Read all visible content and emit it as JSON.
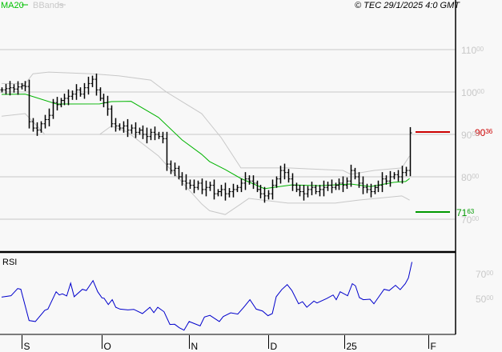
{
  "header": {
    "legend": [
      {
        "label": "MA20",
        "color": "#00c000"
      },
      {
        "label": "BBands",
        "color": "#c8c8c8"
      }
    ],
    "copyright": "© TEC 29/1/2025 4:0 GMT"
  },
  "colors": {
    "price": "#000000",
    "ma": "#00b400",
    "bands": "#c8c8c8",
    "rsi": "#0000cc",
    "resistance": "#cc0000",
    "support": "#009900",
    "grid": "#c8c8c8"
  },
  "chart_data": [
    {
      "type": "ohlc",
      "title": "Price",
      "x_labels": [
        {
          "day": 5,
          "label": "S"
        },
        {
          "day": 25.5,
          "label": "O"
        },
        {
          "day": 47.8,
          "label": "N"
        },
        {
          "day": 68,
          "label": "D"
        },
        {
          "day": 87.4,
          "label": "25"
        },
        {
          "day": 108.8,
          "label": "F"
        }
      ],
      "y_ticks": [
        {
          "value": 11000,
          "main": "110",
          "sup": "00"
        },
        {
          "value": 10000,
          "main": "100",
          "sup": "00"
        },
        {
          "value": 9000,
          "main": "90",
          "sup": "00"
        },
        {
          "value": 8000,
          "main": "80",
          "sup": "00"
        },
        {
          "value": 7000,
          "main": "70",
          "sup": "00"
        }
      ],
      "ylim": [
        6250,
        11800
      ],
      "xlim": [
        -0.4,
        115.7
      ],
      "close": [
        10050,
        10080,
        10100,
        10070,
        10120,
        10150,
        10130,
        9300,
        9150,
        9100,
        9250,
        9350,
        9450,
        9750,
        9700,
        9800,
        9850,
        9900,
        9950,
        10050,
        9950,
        10100,
        10200,
        10300,
        10050,
        9850,
        9750,
        9600,
        9250,
        9200,
        9150,
        9200,
        9100,
        9150,
        9050,
        9100,
        9000,
        8950,
        9050,
        9000,
        8950,
        8900,
        8300,
        8150,
        8200,
        8000,
        7900,
        7850,
        7800,
        7750,
        7850,
        7700,
        7750,
        7800,
        7600,
        7650,
        7700,
        7600,
        7650,
        7700,
        7750,
        7850,
        7950,
        7900,
        7850,
        7700,
        7600,
        7550,
        7600,
        7800,
        7950,
        8150,
        8100,
        7950,
        7800,
        7700,
        7650,
        7600,
        7700,
        7750,
        7650,
        7700,
        7750,
        7800,
        7750,
        7800,
        7850,
        7800,
        7900,
        8150,
        8000,
        7850,
        7750,
        7700,
        7650,
        7750,
        7800,
        7950,
        7900,
        8000,
        8050,
        8000,
        8100,
        8150,
        9036
      ],
      "ma20": [
        [
          0,
          9943
        ],
        [
          6,
          9950
        ],
        [
          14,
          9717
        ],
        [
          25,
          9720
        ],
        [
          28,
          9774
        ],
        [
          33,
          9780
        ],
        [
          40,
          9400
        ],
        [
          46,
          8870
        ],
        [
          51,
          8530
        ],
        [
          53,
          8360
        ],
        [
          57,
          8170
        ],
        [
          61,
          7960
        ],
        [
          67,
          7720
        ],
        [
          70,
          7760
        ],
        [
          74,
          7810
        ],
        [
          81,
          7790
        ],
        [
          89,
          7830
        ],
        [
          94,
          7770
        ],
        [
          100,
          7870
        ],
        [
          103,
          7890
        ],
        [
          104,
          7960
        ]
      ],
      "bb_upper": [
        [
          0,
          10200
        ],
        [
          6,
          10190
        ],
        [
          8,
          10430
        ],
        [
          12,
          10470
        ],
        [
          23,
          10430
        ],
        [
          30,
          10380
        ],
        [
          38,
          10280
        ],
        [
          42,
          10000
        ],
        [
          51,
          9490
        ],
        [
          56,
          8920
        ],
        [
          61,
          8210
        ],
        [
          64,
          8210
        ],
        [
          73,
          8210
        ],
        [
          87,
          8150
        ],
        [
          89,
          8060
        ],
        [
          95,
          8150
        ],
        [
          102,
          8210
        ],
        [
          104,
          8490
        ]
      ],
      "bb_lower": [
        [
          0,
          9430
        ],
        [
          6,
          9490
        ],
        [
          8,
          9300
        ],
        [
          11,
          9000
        ],
        [
          25,
          9000
        ],
        [
          28,
          9200
        ],
        [
          32,
          9060
        ],
        [
          40,
          8490
        ],
        [
          51,
          7360
        ],
        [
          53,
          7200
        ],
        [
          57,
          7110
        ],
        [
          61,
          7360
        ],
        [
          63,
          7490
        ],
        [
          73,
          7380
        ],
        [
          85,
          7380
        ],
        [
          91,
          7450
        ],
        [
          102,
          7550
        ],
        [
          104,
          7450
        ]
      ],
      "levels": [
        {
          "name": "resistance",
          "value": 9036,
          "main": "90",
          "sup": "36"
        },
        {
          "name": "support",
          "value": 7163,
          "main": "71",
          "sup": "63"
        }
      ]
    },
    {
      "type": "line",
      "title": "RSI",
      "ylim": [
        14,
        87
      ],
      "y_ticks": [
        {
          "value": 70,
          "main": "70",
          "sup": "00"
        },
        {
          "value": 50,
          "main": "50",
          "sup": "00"
        }
      ],
      "rsi": [
        [
          0,
          51.7
        ],
        [
          2.4,
          52.8
        ],
        [
          4.1,
          58.6
        ],
        [
          4.9,
          58
        ],
        [
          7,
          32.8
        ],
        [
          8.6,
          32
        ],
        [
          11,
          41
        ],
        [
          11.8,
          42
        ],
        [
          13.9,
          56
        ],
        [
          14.7,
          53.4
        ],
        [
          15.5,
          54.3
        ],
        [
          16.6,
          52.6
        ],
        [
          17.6,
          62.9
        ],
        [
          18.5,
          52
        ],
        [
          20.6,
          58
        ],
        [
          21.6,
          57
        ],
        [
          23.3,
          65
        ],
        [
          24.5,
          56
        ],
        [
          25.6,
          51
        ],
        [
          26.1,
          50.8
        ],
        [
          27.2,
          45.7
        ],
        [
          28.2,
          49.6
        ],
        [
          29.1,
          43.5
        ],
        [
          30.2,
          42
        ],
        [
          32.2,
          41.4
        ],
        [
          33.7,
          41.8
        ],
        [
          35.9,
          38.4
        ],
        [
          37.8,
          43.5
        ],
        [
          38.8,
          39.2
        ],
        [
          39.8,
          43.5
        ],
        [
          41.4,
          39.9
        ],
        [
          42.9,
          29.6
        ],
        [
          44.1,
          29.8
        ],
        [
          45.3,
          27
        ],
        [
          46.5,
          25
        ],
        [
          47.8,
          32
        ],
        [
          49.4,
          30
        ],
        [
          50.6,
          28.5
        ],
        [
          51.7,
          35.6
        ],
        [
          53.1,
          37
        ],
        [
          55.5,
          32
        ],
        [
          56.5,
          36
        ],
        [
          58.4,
          39
        ],
        [
          60.2,
          38
        ],
        [
          61.6,
          43
        ],
        [
          63.3,
          49.6
        ],
        [
          64.9,
          42
        ],
        [
          66.5,
          40.5
        ],
        [
          67.9,
          36.7
        ],
        [
          69,
          38.4
        ],
        [
          70,
          52
        ],
        [
          71.4,
          57.7
        ],
        [
          72.8,
          61.8
        ],
        [
          74,
          57
        ],
        [
          75.7,
          46.3
        ],
        [
          76.7,
          48
        ],
        [
          77.8,
          43.5
        ],
        [
          79.6,
          48.5
        ],
        [
          80.4,
          47
        ],
        [
          82.9,
          50.6
        ],
        [
          84.5,
          53.4
        ],
        [
          85.3,
          49.6
        ],
        [
          86.3,
          56
        ],
        [
          88.2,
          52.8
        ],
        [
          89.4,
          62.5
        ],
        [
          90.2,
          60.8
        ],
        [
          91.2,
          51.3
        ],
        [
          92.2,
          49.6
        ],
        [
          93.9,
          50
        ],
        [
          94.9,
          46.3
        ],
        [
          97.5,
          58
        ],
        [
          98.8,
          57
        ],
        [
          100.4,
          61.2
        ],
        [
          101.6,
          57.7
        ],
        [
          102.9,
          62.5
        ],
        [
          103.7,
          67.2
        ],
        [
          104.6,
          80
        ]
      ]
    }
  ]
}
